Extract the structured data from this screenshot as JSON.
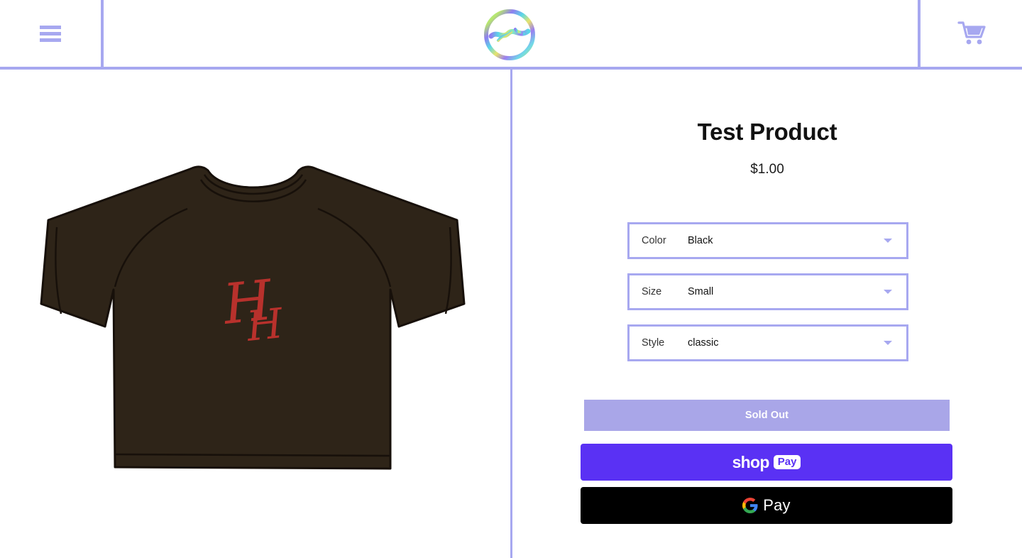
{
  "header": {
    "menu_icon": "hamburger-menu-icon",
    "logo_alt": "brand-logo",
    "cart_icon": "shopping-cart-icon"
  },
  "gallery": {
    "product_image_alt": "dark brown t-shirt with red script H monogram",
    "shirt_color": "#2e2418",
    "shirt_outline": "#1a130c",
    "monogram_color": "#b8312c",
    "monogram_text": "H"
  },
  "product": {
    "title": "Test Product",
    "price": "$1.00",
    "options": [
      {
        "label": "Color",
        "value": "Black",
        "chevron": "chevron-down-icon"
      },
      {
        "label": "Size",
        "value": "Small",
        "chevron": "chevron-down-icon"
      },
      {
        "label": "Style",
        "value": "classic",
        "chevron": "chevron-down-icon"
      }
    ],
    "buttons": {
      "sold_out": "Sold Out",
      "shop_pay_word": "shop",
      "shop_pay_badge": "Pay",
      "google_pay_word": "Pay"
    }
  },
  "colors": {
    "accent_purple": "#a7a8f0",
    "sold_out_bg": "#a9a6e8",
    "shop_pay_bg": "#5a31f4",
    "google_pay_bg": "#000000"
  }
}
